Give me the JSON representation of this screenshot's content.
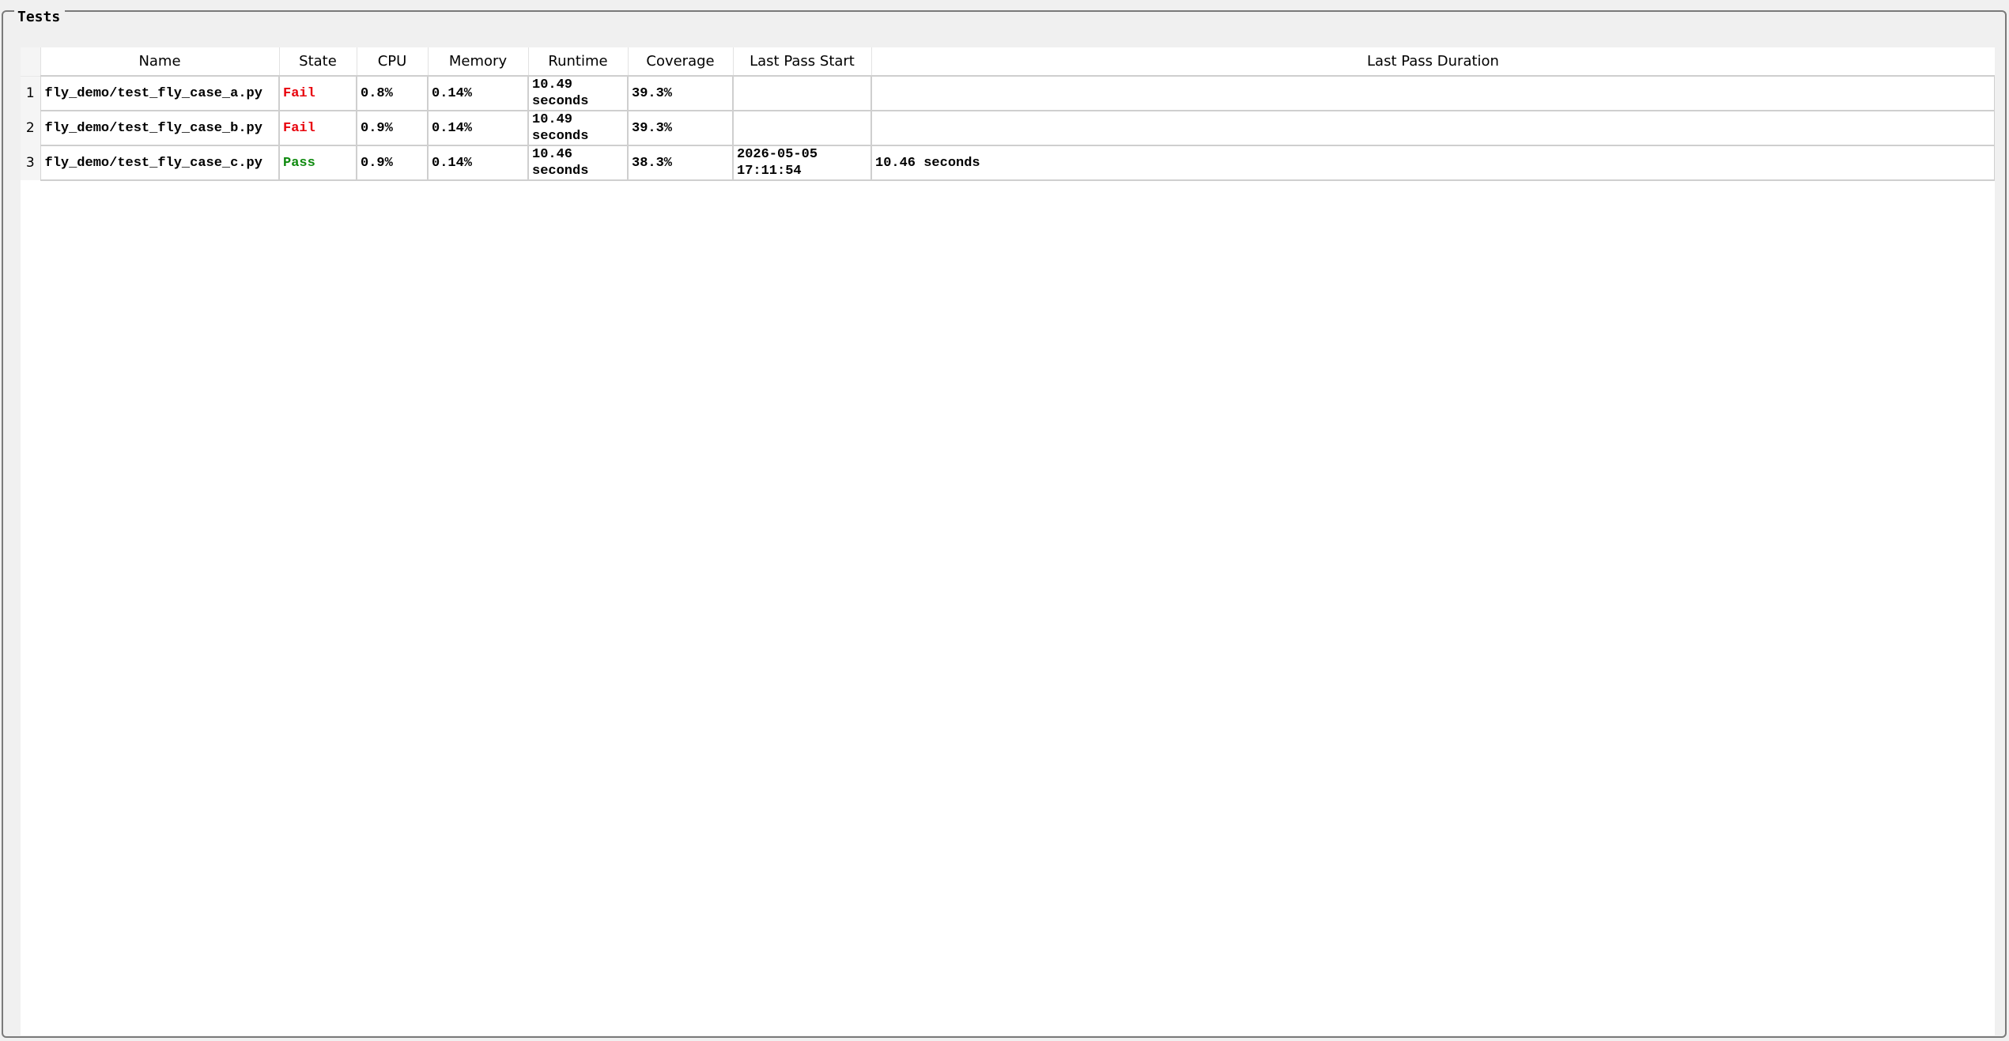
{
  "group": {
    "title": "Tests"
  },
  "columns": [
    "Name",
    "State",
    "CPU",
    "Memory",
    "Runtime",
    "Coverage",
    "Last Pass Start",
    "Last Pass Duration"
  ],
  "rows": [
    {
      "index": "1",
      "name": "fly_demo/test_fly_case_a.py",
      "state": "Fail",
      "cpu": "0.8%",
      "memory": "0.14%",
      "runtime": "10.49\nseconds",
      "coverage": "39.3%",
      "last_pass_start": "",
      "last_pass_duration": ""
    },
    {
      "index": "2",
      "name": "fly_demo/test_fly_case_b.py",
      "state": "Fail",
      "cpu": "0.9%",
      "memory": "0.14%",
      "runtime": "10.49\nseconds",
      "coverage": "39.3%",
      "last_pass_start": "",
      "last_pass_duration": ""
    },
    {
      "index": "3",
      "name": "fly_demo/test_fly_case_c.py",
      "state": "Pass",
      "cpu": "0.9%",
      "memory": "0.14%",
      "runtime": "10.46\nseconds",
      "coverage": "38.3%",
      "last_pass_start": "2026-05-05\n17:11:54",
      "last_pass_duration": "10.46 seconds"
    }
  ],
  "colors": {
    "fail": "#e8000b",
    "pass": "#0f8a0f"
  }
}
